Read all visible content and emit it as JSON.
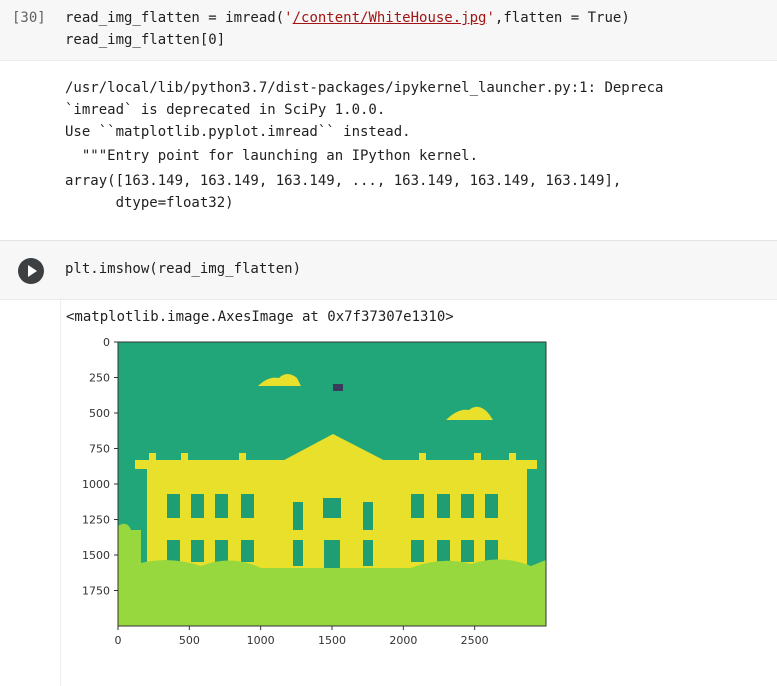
{
  "cell1": {
    "exec_count": "[30]",
    "code_prefix": "read_img_flatten = imread(",
    "code_quote_open": "'",
    "code_path": "/content/WhiteHouse.jpg",
    "code_quote_close": "'",
    "code_suffix": ",flatten = True)",
    "code_line2": "read_img_flatten[0]"
  },
  "output1": {
    "lines": [
      "/usr/local/lib/python3.7/dist-packages/ipykernel_launcher.py:1: Depreca",
      "`imread` is deprecated in SciPy 1.0.0.",
      "Use ``matplotlib.pyplot.imread`` instead.",
      "  \"\"\"Entry point for launching an IPython kernel.",
      "array([163.149, 163.149, 163.149, ..., 163.149, 163.149, 163.149],",
      "      dtype=float32)"
    ]
  },
  "cell2": {
    "code": "plt.imshow(read_img_flatten)"
  },
  "output2": {
    "repr": "<matplotlib.image.AxesImage at 0x7f37307e1310>"
  },
  "colors": {
    "sky": "#21a67a",
    "building": "#e8e02a",
    "windows": "#1f9e73",
    "lawn": "#98d83f",
    "flag": "#3a3a5a"
  },
  "chart_data": {
    "type": "heatmap",
    "title": "",
    "xlabel": "",
    "ylabel": "",
    "xlim": [
      0,
      3000
    ],
    "ylim": [
      2000,
      0
    ],
    "xticks": [
      0,
      500,
      1000,
      1500,
      2000,
      2500
    ],
    "yticks": [
      0,
      250,
      500,
      750,
      1000,
      1250,
      1500,
      1750
    ]
  }
}
